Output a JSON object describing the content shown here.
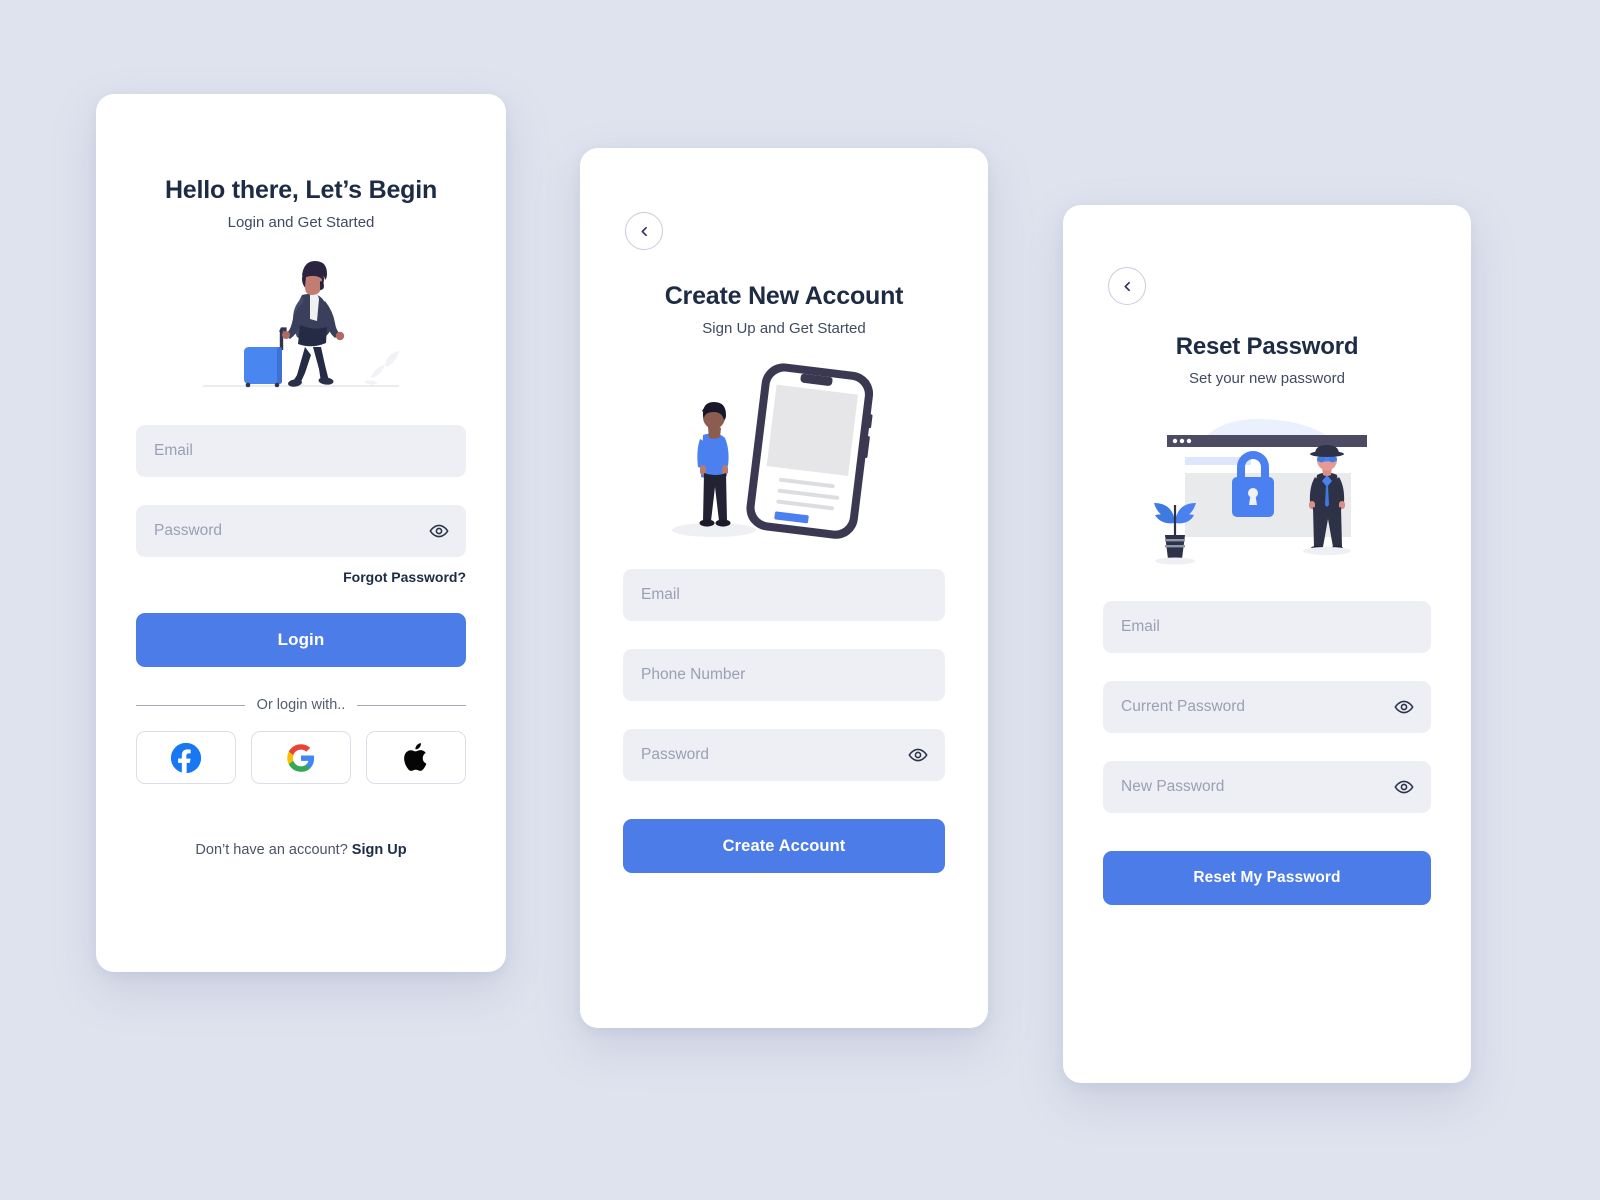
{
  "theme": {
    "page_background": "#dfe3ee",
    "card_background": "#ffffff",
    "accent_blue": "#4c7ce8",
    "input_background": "#eeeff4",
    "heading_color": "#1e2b45",
    "placeholder_color": "#9aa0b4"
  },
  "login": {
    "title": "Hello there, Let’s Begin",
    "subtitle": "Login and Get Started",
    "illustration": "woman-with-suitcase-illustration",
    "fields": [
      {
        "name": "email",
        "placeholder": "Email",
        "value": "",
        "type": "text",
        "has_eye": false
      },
      {
        "name": "password",
        "placeholder": "Password",
        "value": "",
        "type": "password",
        "has_eye": true
      }
    ],
    "forgot_label": "Forgot Password?",
    "submit_label": "Login",
    "divider_label": "Or login with..",
    "social": [
      {
        "name": "facebook",
        "icon": "facebook-icon"
      },
      {
        "name": "google",
        "icon": "google-icon"
      },
      {
        "name": "apple",
        "icon": "apple-icon"
      }
    ],
    "footer_text": "Don’t have an account? ",
    "footer_link": "Sign Up"
  },
  "signup": {
    "back_icon": "chevron-left-icon",
    "title": "Create New Account",
    "subtitle": "Sign Up and Get Started",
    "illustration": "man-looking-at-phone-illustration",
    "fields": [
      {
        "name": "email",
        "placeholder": "Email",
        "value": "",
        "type": "text",
        "has_eye": false
      },
      {
        "name": "phone",
        "placeholder": "Phone Number",
        "value": "",
        "type": "text",
        "has_eye": false
      },
      {
        "name": "password",
        "placeholder": "Password",
        "value": "",
        "type": "password",
        "has_eye": true
      }
    ],
    "submit_label": "Create Account"
  },
  "reset": {
    "back_icon": "chevron-left-icon",
    "title": "Reset Password",
    "subtitle": "Set your new password",
    "illustration": "security-lock-browser-illustration",
    "fields": [
      {
        "name": "email",
        "placeholder": "Email",
        "value": "",
        "type": "text",
        "has_eye": false
      },
      {
        "name": "current-password",
        "placeholder": "Current Password",
        "value": "",
        "type": "password",
        "has_eye": true
      },
      {
        "name": "new-password",
        "placeholder": "New Password",
        "value": "",
        "type": "password",
        "has_eye": true
      }
    ],
    "submit_label": "Reset My Password"
  }
}
